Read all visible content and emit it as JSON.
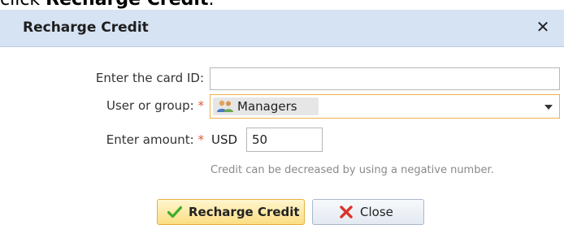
{
  "page": {
    "instruction_prefix": "click ",
    "instruction_bold": "Recharge Credit",
    "instruction_suffix": "."
  },
  "dialog": {
    "title": "Recharge Credit",
    "close_glyph": "✕"
  },
  "form": {
    "card_id_label": "Enter the card ID:",
    "card_id_value": "",
    "user_group_label": "User or group:",
    "required_marker": "*",
    "user_group_selected": "Managers",
    "amount_label": "Enter amount:",
    "currency": "USD",
    "amount_value": "50",
    "hint": "Credit can be decreased by using a negative number."
  },
  "buttons": {
    "recharge_label": "Recharge Credit",
    "close_label": "Close"
  },
  "icons": {
    "group": "group-icon",
    "check": "check-icon",
    "cross": "cross-icon"
  },
  "colors": {
    "titlebar_bg": "#d6e3f2",
    "required": "#e05a3a",
    "select_focus_border": "#f0b24a",
    "primary_button": "#fbdd82",
    "check_green": "#3fae2a",
    "cross_red": "#d9342b"
  }
}
